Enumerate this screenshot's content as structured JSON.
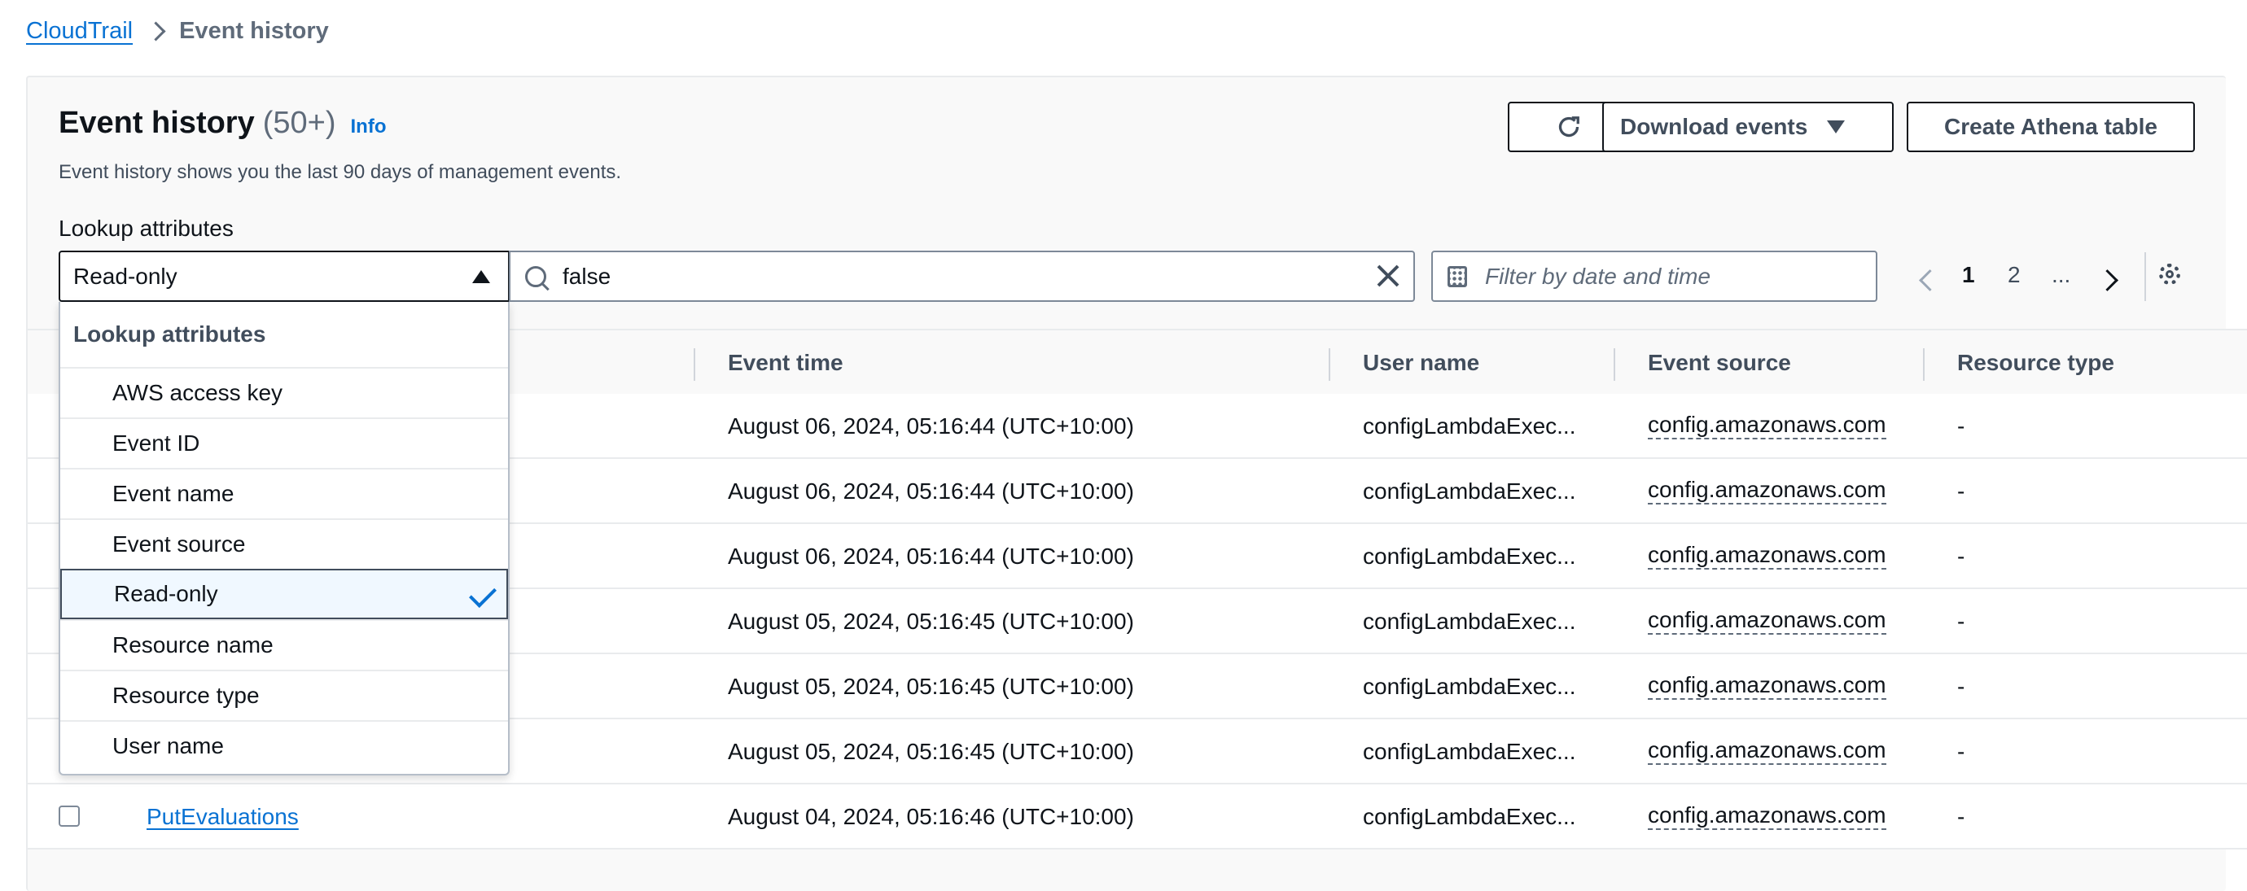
{
  "breadcrumb": {
    "root": "CloudTrail",
    "current": "Event history"
  },
  "header": {
    "title": "Event history",
    "count": "(50+)",
    "info": "Info",
    "description": "Event history shows you the last 90 days of management events."
  },
  "toolbar": {
    "download_label": "Download events",
    "athena_label": "Create Athena table"
  },
  "lookup": {
    "label": "Lookup attributes",
    "selected": "Read-only",
    "search_value": "false",
    "date_placeholder": "Filter by date and time"
  },
  "pagination": {
    "current": "1",
    "next": "2",
    "ellipsis": "..."
  },
  "table": {
    "columns": [
      "Event time",
      "User name",
      "Event source",
      "Resource type"
    ],
    "rows": [
      {
        "event_name": "",
        "time": "August 06, 2024, 05:16:44 (UTC+10:00)",
        "user": "configLambdaExec...",
        "source": "config.amazonaws.com",
        "resource_type": "-"
      },
      {
        "event_name": "",
        "time": "August 06, 2024, 05:16:44 (UTC+10:00)",
        "user": "configLambdaExec...",
        "source": "config.amazonaws.com",
        "resource_type": "-"
      },
      {
        "event_name": "",
        "time": "August 06, 2024, 05:16:44 (UTC+10:00)",
        "user": "configLambdaExec...",
        "source": "config.amazonaws.com",
        "resource_type": "-"
      },
      {
        "event_name": "",
        "time": "August 05, 2024, 05:16:45 (UTC+10:00)",
        "user": "configLambdaExec...",
        "source": "config.amazonaws.com",
        "resource_type": "-"
      },
      {
        "event_name": "",
        "time": "August 05, 2024, 05:16:45 (UTC+10:00)",
        "user": "configLambdaExec...",
        "source": "config.amazonaws.com",
        "resource_type": "-"
      },
      {
        "event_name": "",
        "time": "August 05, 2024, 05:16:45 (UTC+10:00)",
        "user": "configLambdaExec...",
        "source": "config.amazonaws.com",
        "resource_type": "-"
      },
      {
        "event_name": "PutEvaluations",
        "time": "August 04, 2024, 05:16:46 (UTC+10:00)",
        "user": "configLambdaExec...",
        "source": "config.amazonaws.com",
        "resource_type": "-"
      }
    ]
  },
  "dropdown": {
    "header": "Lookup attributes",
    "options": [
      "AWS access key",
      "Event ID",
      "Event name",
      "Event source",
      "Read-only",
      "Resource name",
      "Resource type",
      "User name"
    ],
    "selected_index": 4
  }
}
